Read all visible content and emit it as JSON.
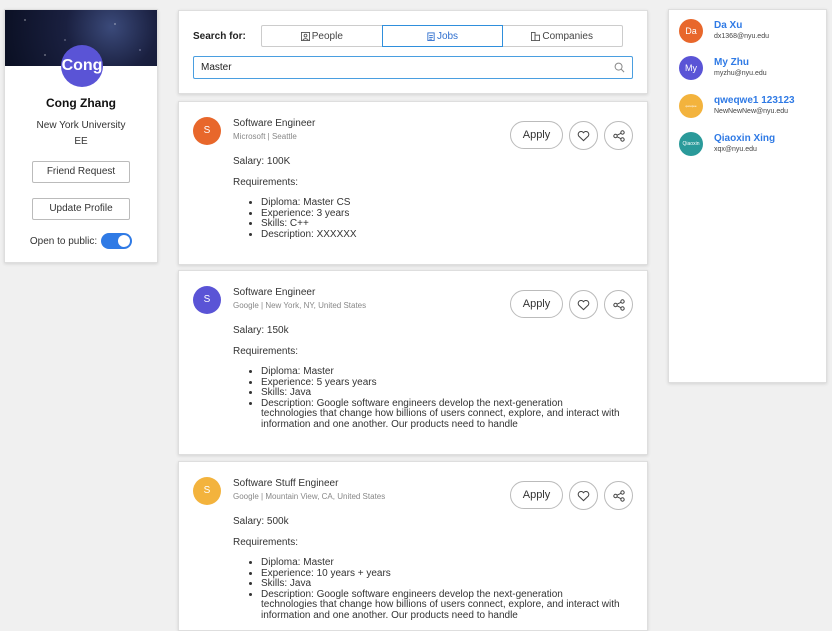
{
  "profile": {
    "avatar_text": "Cong",
    "name": "Cong Zhang",
    "university": "New York University",
    "major": "EE",
    "friend_request_label": "Friend Request",
    "update_profile_label": "Update Profile",
    "public_label": "Open to public:",
    "public_enabled": true
  },
  "search": {
    "label": "Search for:",
    "tabs": [
      {
        "label": "People",
        "icon": "person-box-icon"
      },
      {
        "label": "Jobs",
        "icon": "clipboard-icon",
        "active": true
      },
      {
        "label": "Companies",
        "icon": "building-icon"
      }
    ],
    "query": "Master"
  },
  "jobs": [
    {
      "logo": "S",
      "logo_color": "#e8672b",
      "title": "Software Engineer",
      "company": "Microsoft | Seattle",
      "apply_label": "Apply",
      "salary": "Salary: 100K",
      "requirements_label": "Requirements:",
      "requirements": [
        "Diploma: Master CS",
        "Experience: 3 years",
        "Skills: C++",
        "Description: XXXXXX"
      ]
    },
    {
      "logo": "S",
      "logo_color": "#5a54d6",
      "title": "Software Engineer",
      "company": "Google | New York, NY, United States",
      "apply_label": "Apply",
      "salary": "Salary: 150k",
      "requirements_label": "Requirements:",
      "requirements": [
        "Diploma: Master",
        "Experience: 5 years years",
        "Skills: Java",
        "Description: Google software engineers develop the next-generation technologies that change how billions of users connect, explore, and interact with information and one another. Our products need to handle"
      ]
    },
    {
      "logo": "S",
      "logo_color": "#f3b33d",
      "title": "Software Stuff Engineer",
      "company": "Google | Mountain View, CA, United States",
      "apply_label": "Apply",
      "salary": "Salary: 500k",
      "requirements_label": "Requirements:",
      "requirements": [
        "Diploma: Master",
        "Experience: 10 years + years",
        "Skills: Java",
        "Description: Google software engineers develop the next-generation technologies that change how billions of users connect, explore, and interact with information and one another. Our products need to handle"
      ]
    }
  ],
  "contacts": [
    {
      "avatar": "Da",
      "color": "#e8672b",
      "name": "Da Xu",
      "email": "dx1368@nyu.edu"
    },
    {
      "avatar": "My",
      "color": "#5a54d6",
      "name": "My Zhu",
      "email": "myzhu@nyu.edu"
    },
    {
      "avatar": "qweqwe",
      "color": "#f3b33d",
      "name": "qweqwe1 123123",
      "email": "NewNewNew@nyu.edu"
    },
    {
      "avatar": "Qiaoxin",
      "color": "#2a9a9a",
      "name": "Qiaoxin Xing",
      "email": "xqx@nyu.edu"
    }
  ]
}
